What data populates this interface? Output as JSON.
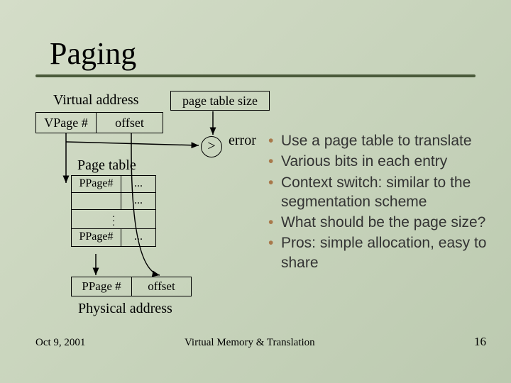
{
  "title": "Paging",
  "virtual_address": {
    "label": "Virtual address",
    "vpage": "VPage #",
    "offset": "offset"
  },
  "page_table_size_label": "page table size",
  "compare_op": ">",
  "error_label": "error",
  "page_table": {
    "label": "Page table",
    "row1_left": "PPage#",
    "row1_right": "...",
    "row2_right": "...",
    "rowN_left": "PPage#",
    "rowN_right": "..."
  },
  "physical_address": {
    "ppage": "PPage #",
    "offset": "offset",
    "label": "Physical address"
  },
  "bullets": [
    "Use a page table to translate",
    "Various bits in each entry",
    "Context switch: similar to the segmentation scheme",
    "What should be the page size?",
    "Pros: simple allocation, easy to share"
  ],
  "footer": {
    "date": "Oct 9, 2001",
    "center": "Virtual Memory & Translation",
    "page": "16"
  }
}
